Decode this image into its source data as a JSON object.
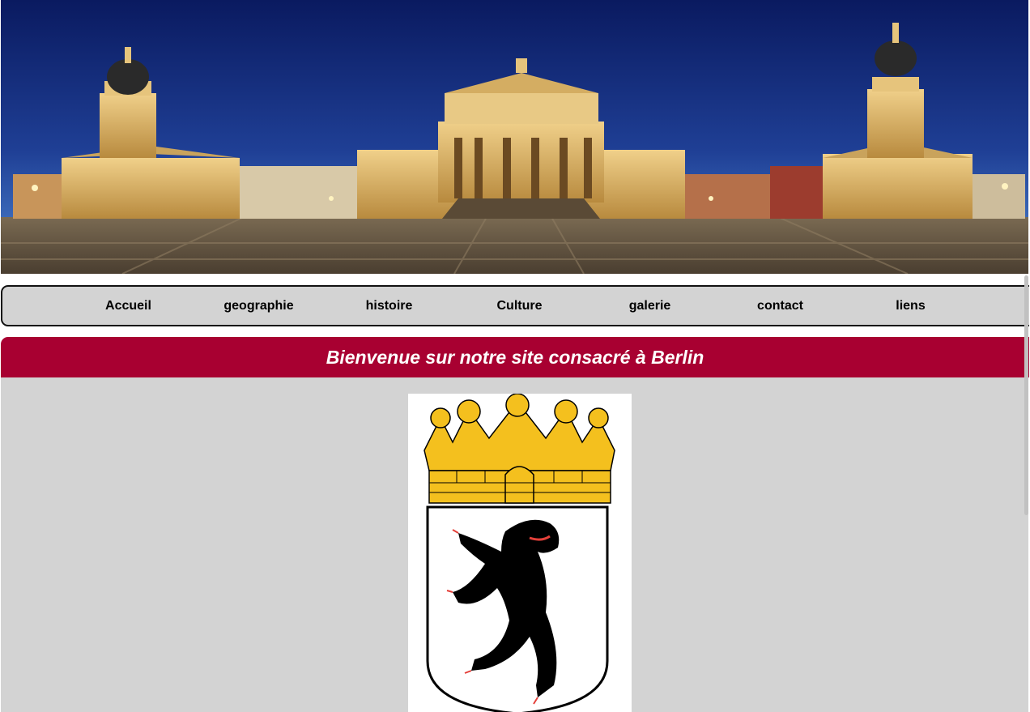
{
  "banner": {
    "image": "Gendarmenmarkt Berlin panorama at night",
    "colors": {
      "sky_top": "#0b1e6a",
      "sky_bottom": "#2f5fb8",
      "building": "#d9b36a",
      "ground": "#6b5a45"
    }
  },
  "nav": {
    "items": [
      {
        "label": "Accueil"
      },
      {
        "label": "geographie"
      },
      {
        "label": "histoire"
      },
      {
        "label": "Culture"
      },
      {
        "label": "galerie"
      },
      {
        "label": "contact"
      },
      {
        "label": "liens"
      }
    ],
    "background": "#d3d3d3"
  },
  "welcome": {
    "text": "Bienvenue sur notre site consacré à Berlin",
    "background": "#a80031"
  },
  "content": {
    "background": "#d3d3d3",
    "coat_of_arms": "Berlin coat of arms: black bear on white shield under golden crown"
  }
}
